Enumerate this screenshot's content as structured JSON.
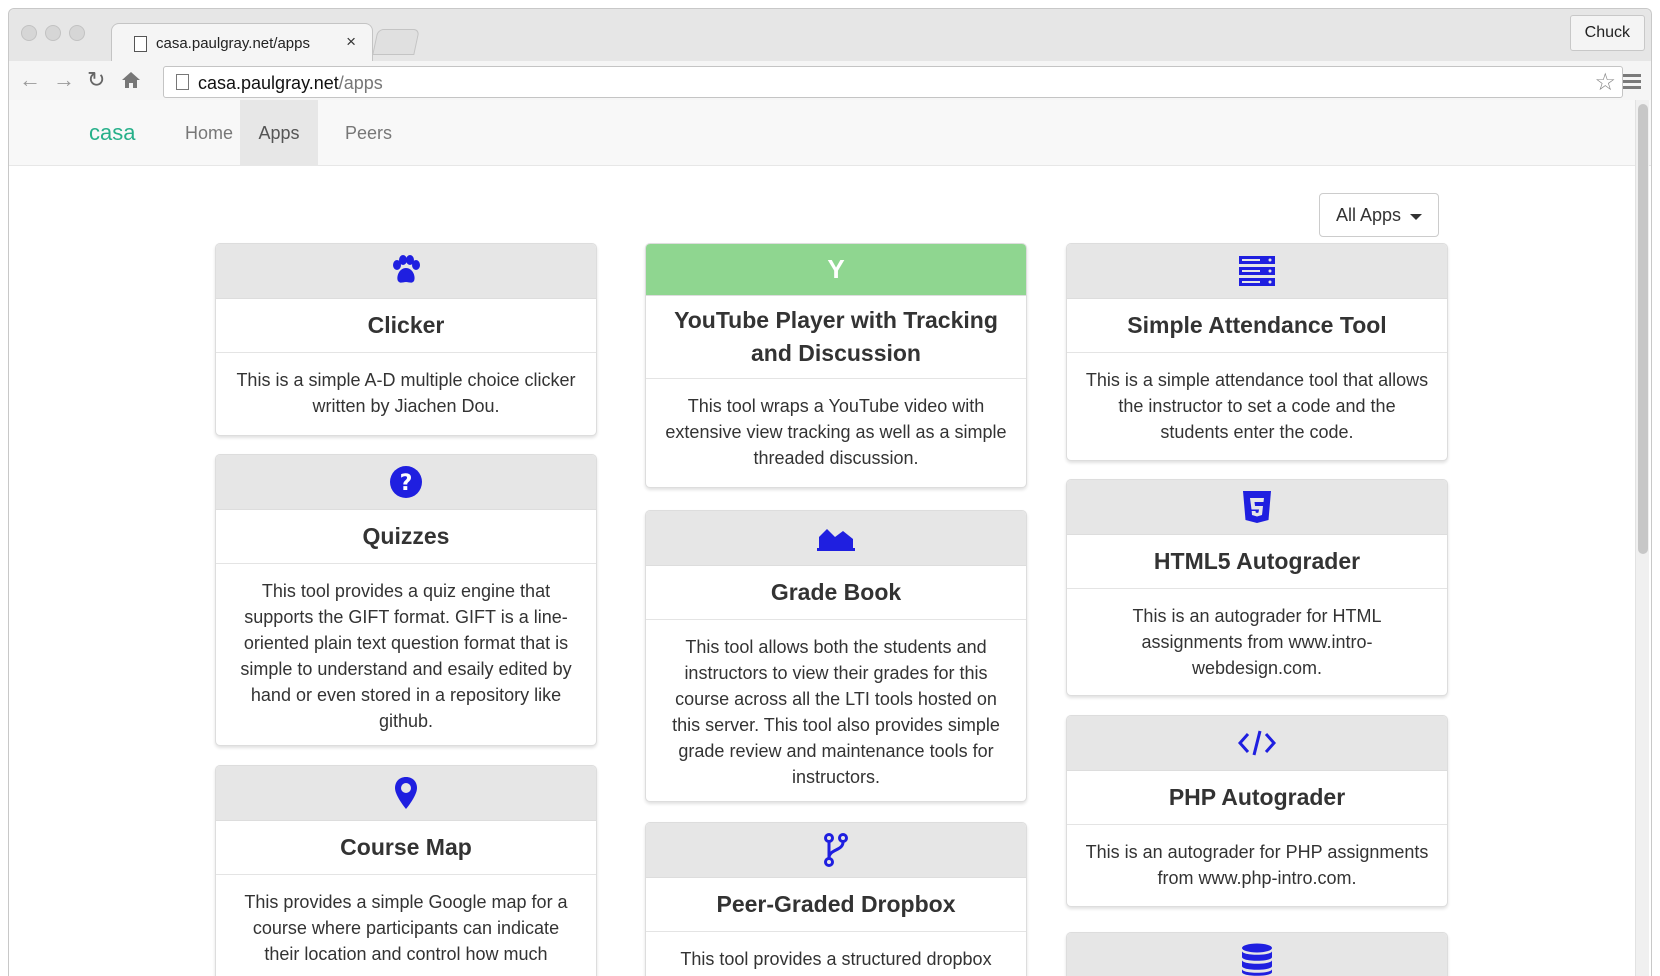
{
  "browser": {
    "tab_title": "casa.paulgray.net/apps",
    "tab_close": "×",
    "user": "Chuck",
    "url_host": "casa.paulgray.net",
    "url_path": "/apps",
    "back_icon": "back-arrow-icon",
    "forward_icon": "forward-arrow-icon",
    "reload_icon": "reload-icon",
    "home_icon": "home-icon",
    "star_icon": "bookmark-star-icon",
    "menu_icon": "hamburger-menu-icon"
  },
  "navbar": {
    "brand": "casa",
    "brand_color": "#27b08a",
    "items": [
      {
        "label": "Home",
        "active": false
      },
      {
        "label": "Apps",
        "active": true
      },
      {
        "label": "Peers",
        "active": false
      }
    ]
  },
  "filter": {
    "label": "All Apps"
  },
  "icon_color": "#1f1fe0",
  "apps": [
    {
      "icon": "paw-icon",
      "title": "Clicker",
      "description": "This is a simple A-D multiple choice clicker written by Jiachen Dou."
    },
    {
      "icon": "question-circle-icon",
      "title": "Quizzes",
      "description": "This tool provides a quiz engine that supports the GIFT format. GIFT is a line-oriented plain text question format that is simple to understand and esaily edited by hand or even stored in a repository like github."
    },
    {
      "icon": "map-marker-icon",
      "title": "Course Map",
      "description": "This provides a simple Google map for a course where participants can indicate their location and control how much"
    },
    {
      "icon": "Y",
      "title": "YouTube Player with Tracking and Discussion",
      "description": "This tool wraps a YouTube video with extensive view tracking as well as a simple threaded discussion.",
      "header_color": "#8fd690"
    },
    {
      "icon": "area-chart-icon",
      "title": "Grade Book",
      "description": "This tool allows both the students and instructors to view their grades for this course across all the LTI tools hosted on this server. This tool also provides simple grade review and maintenance tools for instructors."
    },
    {
      "icon": "code-fork-icon",
      "title": "Peer-Graded Dropbox",
      "description": "This tool provides a structured dropbox"
    },
    {
      "icon": "server-icon",
      "title": "Simple Attendance Tool",
      "description": "This is a simple attendance tool that allows the instructor to set a code and the students enter the code."
    },
    {
      "icon": "html5-icon",
      "title": "HTML5 Autograder",
      "description": "This is an autograder for HTML assignments from www.intro-webdesign.com."
    },
    {
      "icon": "code-icon",
      "title": "PHP Autograder",
      "description": "This is an autograder for PHP assignments from www.php-intro.com."
    },
    {
      "icon": "database-icon",
      "title": "",
      "description": ""
    }
  ]
}
